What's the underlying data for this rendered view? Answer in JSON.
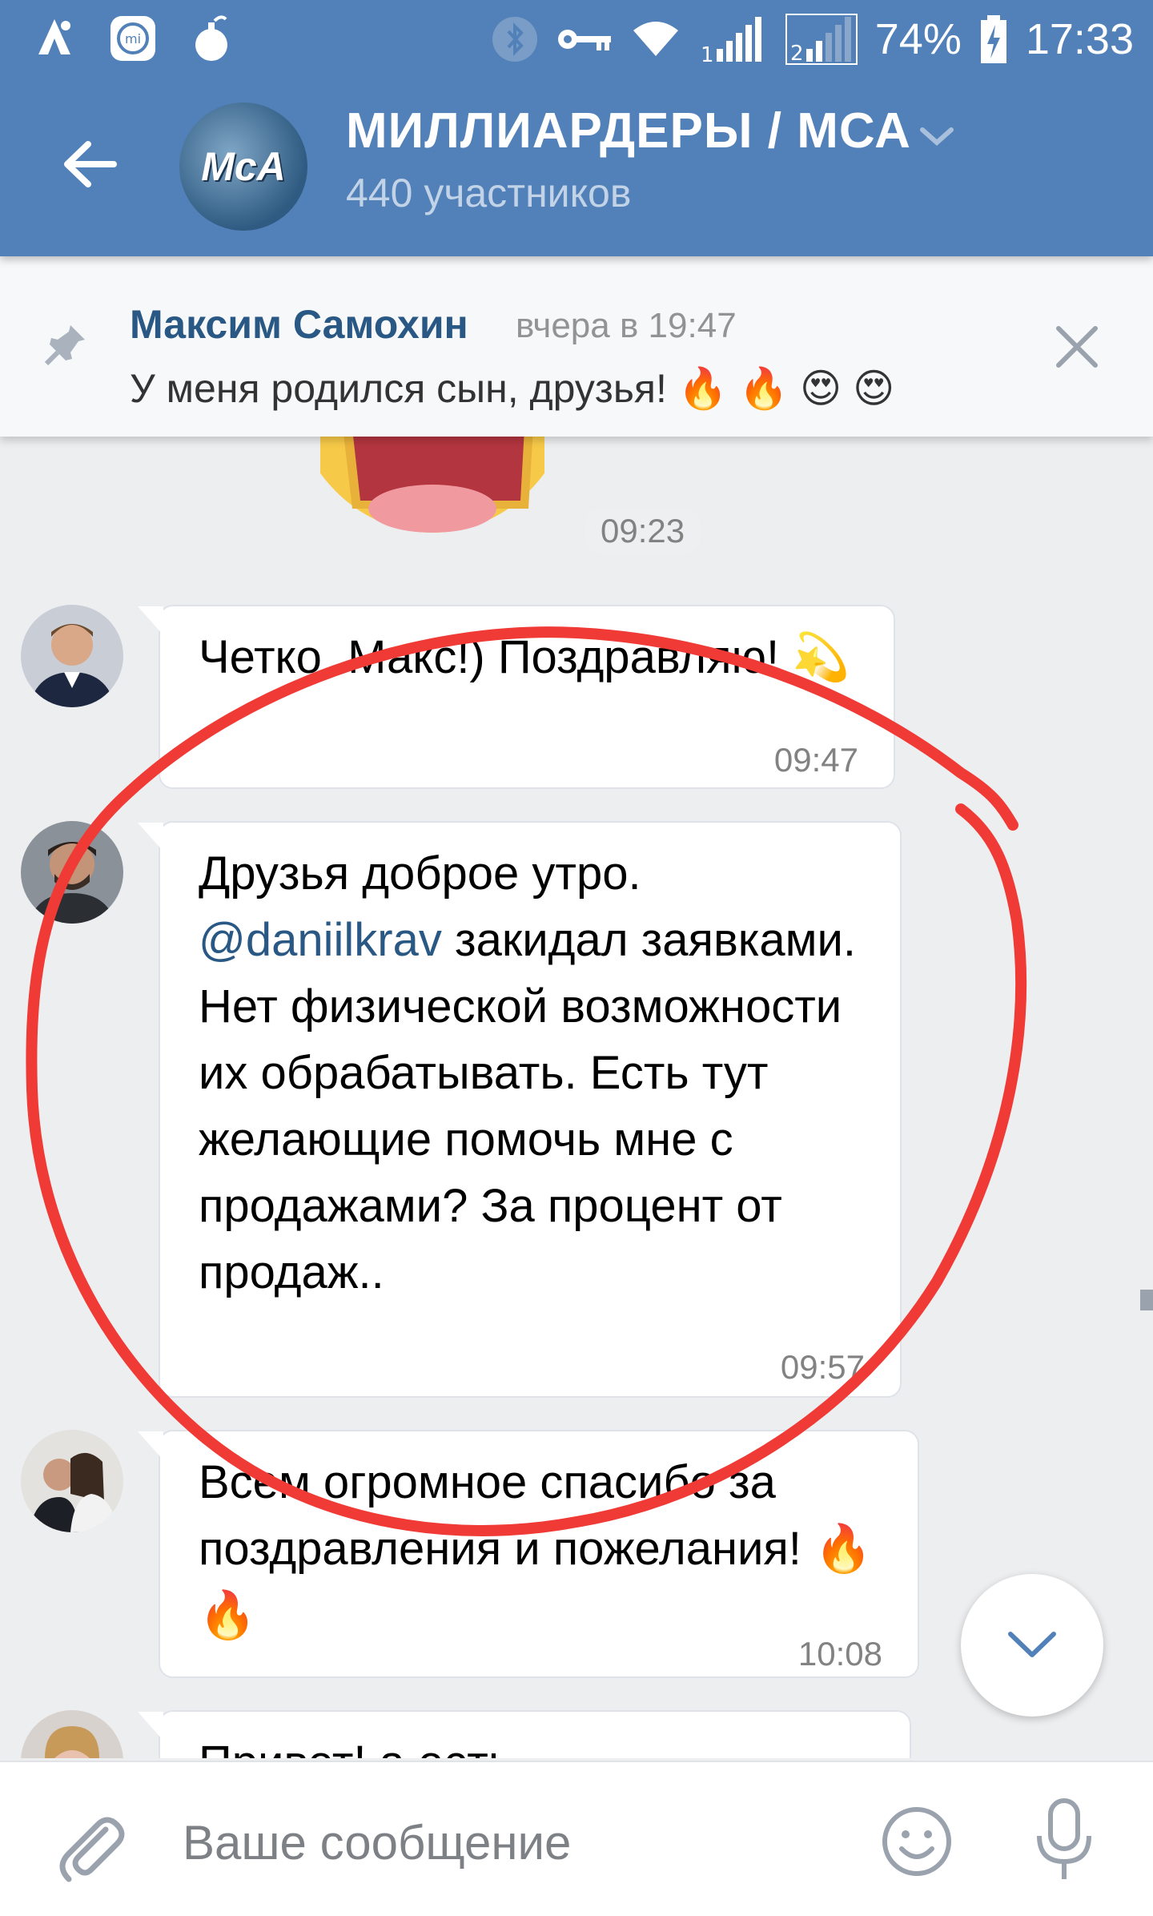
{
  "status_bar": {
    "battery": "74%",
    "time": "17:33",
    "sim1": "1",
    "sim2": "2",
    "icons": [
      "avast-icon",
      "mi-icon",
      "bomb-icon",
      "bluetooth-icon",
      "key-icon",
      "wifi-icon",
      "signal-icon",
      "battery-charging-icon"
    ]
  },
  "header": {
    "avatar_text": "МсА",
    "title": "МИЛЛИАРДЕРЫ / МСА",
    "subtitle": "440 участников"
  },
  "pinned": {
    "author": "Максим Самохин",
    "time": "вчера в 19:47",
    "text": "У меня родился сын, друзья! 🔥 🔥 😍 😍"
  },
  "messages": [
    {
      "text": "Четко, Макс!) Поздравляю! 💫",
      "time": "09:47"
    },
    {
      "text_before": "Друзья доброе утро.",
      "mention": "@daniilkrav",
      "text_after": " закидал заявками. Нет физической возможности их обрабатывать. Есть тут желающие помочь мне с продажами? За процент от продаж..",
      "time": "09:57"
    },
    {
      "text": "Всем огромное спасибо за поздравления и пожелания! 🔥 🔥",
      "time": "10:08"
    },
    {
      "text": "Привет! а есть",
      "time": ""
    }
  ],
  "sticker_time": "09:23",
  "input": {
    "placeholder": "Ваше сообщение"
  },
  "colors": {
    "header": "#5181b8",
    "link": "#2a5885",
    "annotation": "#f03a35"
  }
}
